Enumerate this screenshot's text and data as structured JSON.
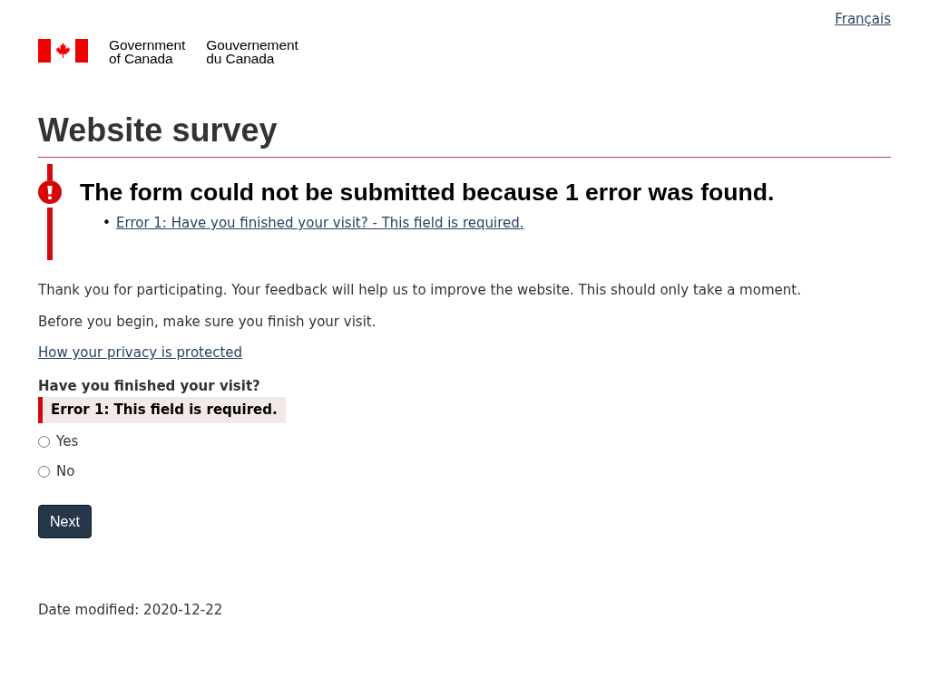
{
  "language_toggle": "Français",
  "signature": {
    "english": [
      "Government",
      "of Canada"
    ],
    "french": [
      "Gouvernement",
      "du Canada"
    ]
  },
  "page_title": "Website survey",
  "error_summary": {
    "heading": "The form could not be submitted because 1 error was found.",
    "errors": [
      {
        "marker": "•",
        "text": "Error 1: Have you finished your visit? - This field is required."
      }
    ]
  },
  "intro": [
    "Thank you for participating. Your feedback will help us to improve the website. This should only take a moment.",
    "Before you begin, make sure you finish your visit."
  ],
  "privacy_link": "How your privacy is protected",
  "question": {
    "label": "Have you finished your visit?",
    "error": "Error 1: This field is required.",
    "options": [
      {
        "label": "Yes",
        "selected": false
      },
      {
        "label": "No",
        "selected": false
      }
    ]
  },
  "next_button": "Next",
  "date_modified": {
    "label": "Date modified:",
    "value": "2020-12-22"
  }
}
